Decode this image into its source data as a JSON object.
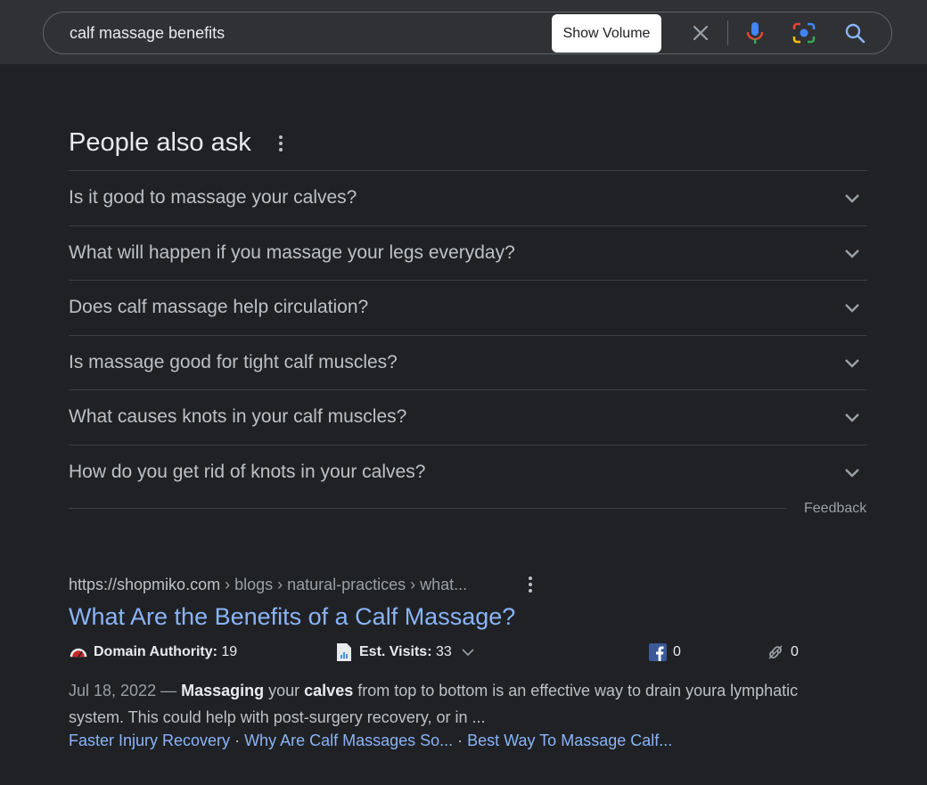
{
  "search": {
    "query": "calf massage benefits",
    "tooltip": "Show Volume",
    "icons": [
      "clear-icon",
      "microphone-icon",
      "camera-lens-icon",
      "search-icon"
    ]
  },
  "paa": {
    "title": "People also ask",
    "questions": [
      "Is it good to massage your calves?",
      "What will happen if you massage your legs everyday?",
      "Does calf massage help circulation?",
      "Is massage good for tight calf muscles?",
      "What causes knots in your calf muscles?",
      "How do you get rid of knots in your calves?"
    ],
    "feedback": "Feedback"
  },
  "result": {
    "site": "https://shopmiko.com",
    "path": " › blogs › natural-practices › what...",
    "title": "What Are the Benefits of a Calf Massage?",
    "metrics": {
      "domain_authority_label": "Domain Authority:",
      "domain_authority_value": "19",
      "est_visits_label": "Est. Visits:",
      "est_visits_value": "33",
      "facebook_value": "0",
      "links_value": "0"
    },
    "snippet": {
      "date": "Jul 18, 2022 — ",
      "b1": "Massaging",
      "t1": " your ",
      "b2": "calves",
      "t2": " from top to bottom is an effective way to drain youra lymphatic system. This could help with post-surgery recovery, or in ..."
    },
    "sitelinks": [
      "Faster Injury Recovery",
      "Why Are Calf Massages So...",
      "Best Way To Massage Calf..."
    ],
    "sitelink_separator": " · "
  },
  "colors": {
    "background": "#202124",
    "link": "#8ab4f8",
    "text": "#bdc1c6",
    "facebook": "#3b5998"
  }
}
